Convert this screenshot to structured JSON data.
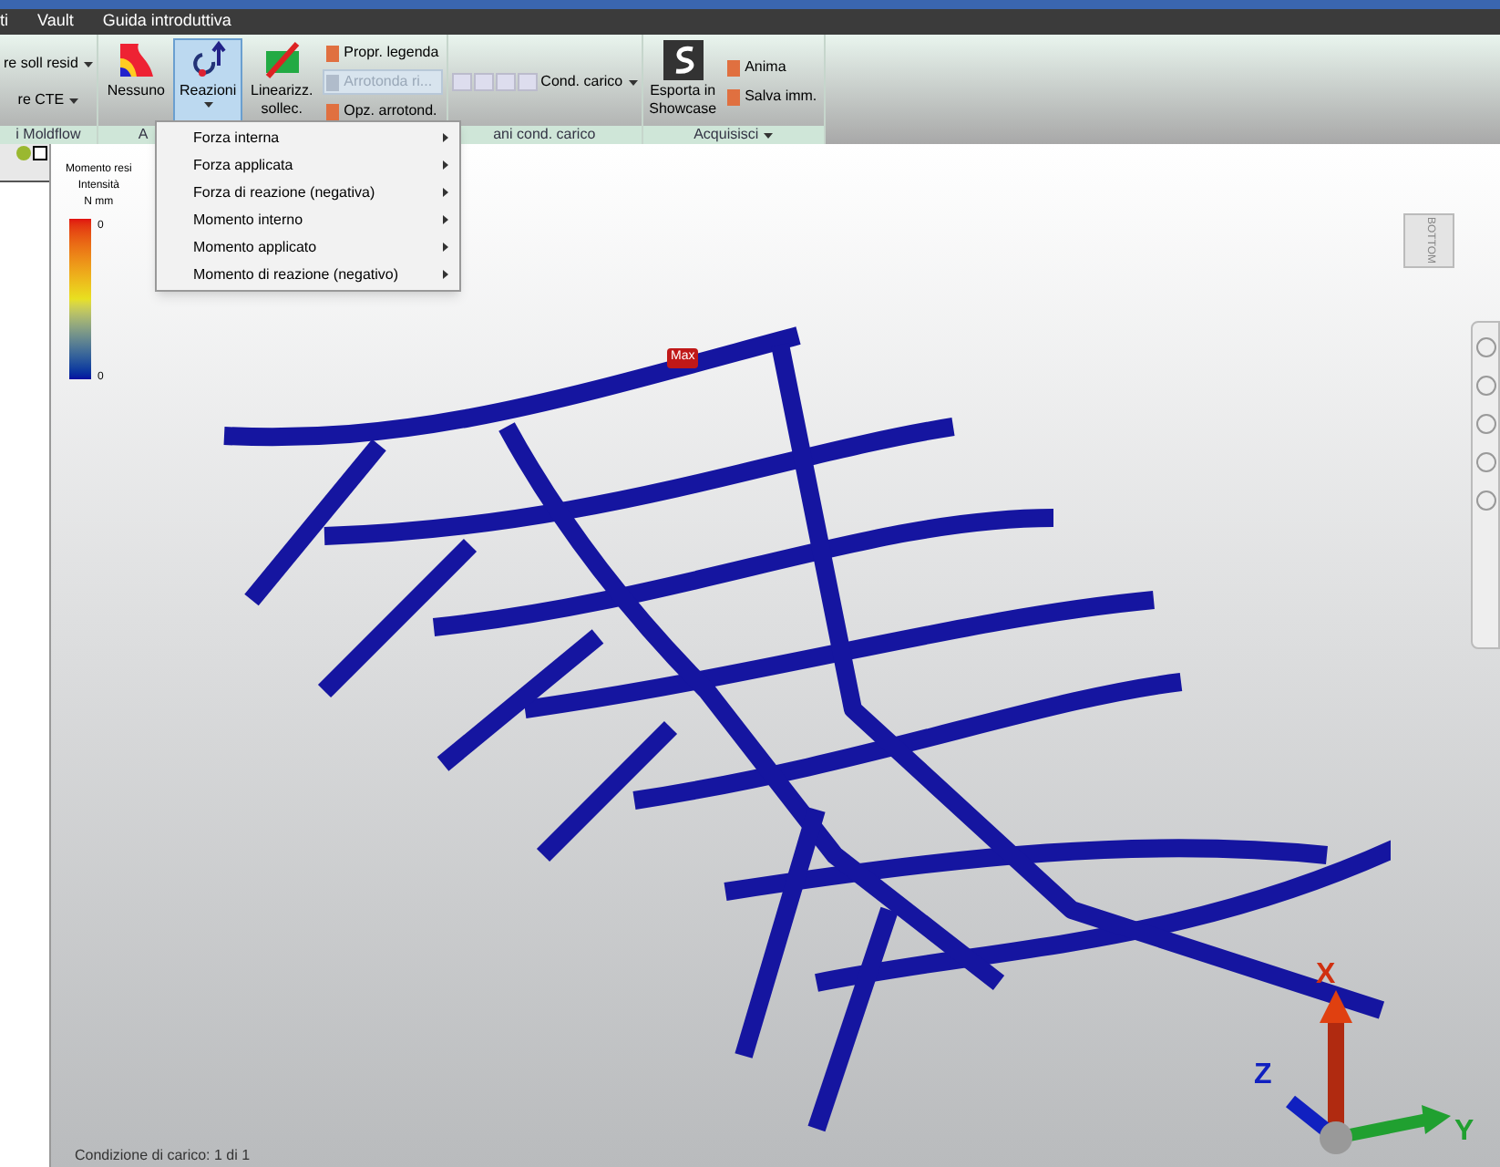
{
  "menu_bar": [
    {
      "label": "ti"
    },
    {
      "label": "Vault"
    },
    {
      "label": "Guida introduttiva"
    }
  ],
  "ribbon": {
    "groups": [
      {
        "label": "i Moldflow",
        "items": [
          {
            "kind": "small",
            "label": "re soll resid",
            "dropdown": true
          },
          {
            "kind": "small",
            "label": "re CTE",
            "dropdown": true
          }
        ]
      },
      {
        "label": "A",
        "items": [
          {
            "kind": "large",
            "label": "Nessuno",
            "selected": false
          },
          {
            "kind": "large",
            "label": "Reazioni",
            "selected": true
          },
          {
            "kind": "large",
            "label": "Linearizz. sollec.",
            "selected": false
          },
          {
            "kind": "stack",
            "entries": [
              {
                "label": "Propr. legenda",
                "disabled": false
              },
              {
                "label": "Arrotonda ri...",
                "disabled": true
              },
              {
                "label": "Opz. arrotond.",
                "disabled": false
              }
            ]
          }
        ]
      },
      {
        "label": "ani cond. carico",
        "items": [
          {
            "kind": "player"
          },
          {
            "kind": "small",
            "label": "Cond. carico",
            "dropdown": true
          }
        ]
      },
      {
        "label": "Acquisisci",
        "dropdown": true,
        "items": [
          {
            "kind": "large",
            "label": "Esporta in Showcase",
            "selected": false
          },
          {
            "kind": "stack",
            "entries": [
              {
                "label": "Anima",
                "disabled": false
              },
              {
                "label": "Salva imm.",
                "disabled": false
              }
            ]
          }
        ]
      }
    ]
  },
  "dropdown_menu": [
    {
      "label": "Forza interna"
    },
    {
      "label": "Forza applicata"
    },
    {
      "label": "Forza di reazione (negativa)"
    },
    {
      "label": "Momento interno"
    },
    {
      "label": "Momento applicato"
    },
    {
      "label": "Momento di reazione (negativo)"
    }
  ],
  "legend": {
    "title": "Momento resi",
    "subtitle": "Intensità",
    "unit": "N mm",
    "max": "0",
    "min": "0"
  },
  "max_label": "Max",
  "viewcube_label": "BOTTOM",
  "axes": [
    "X",
    "Y",
    "Z"
  ],
  "status": "Condizione di carico: 1 di 1"
}
